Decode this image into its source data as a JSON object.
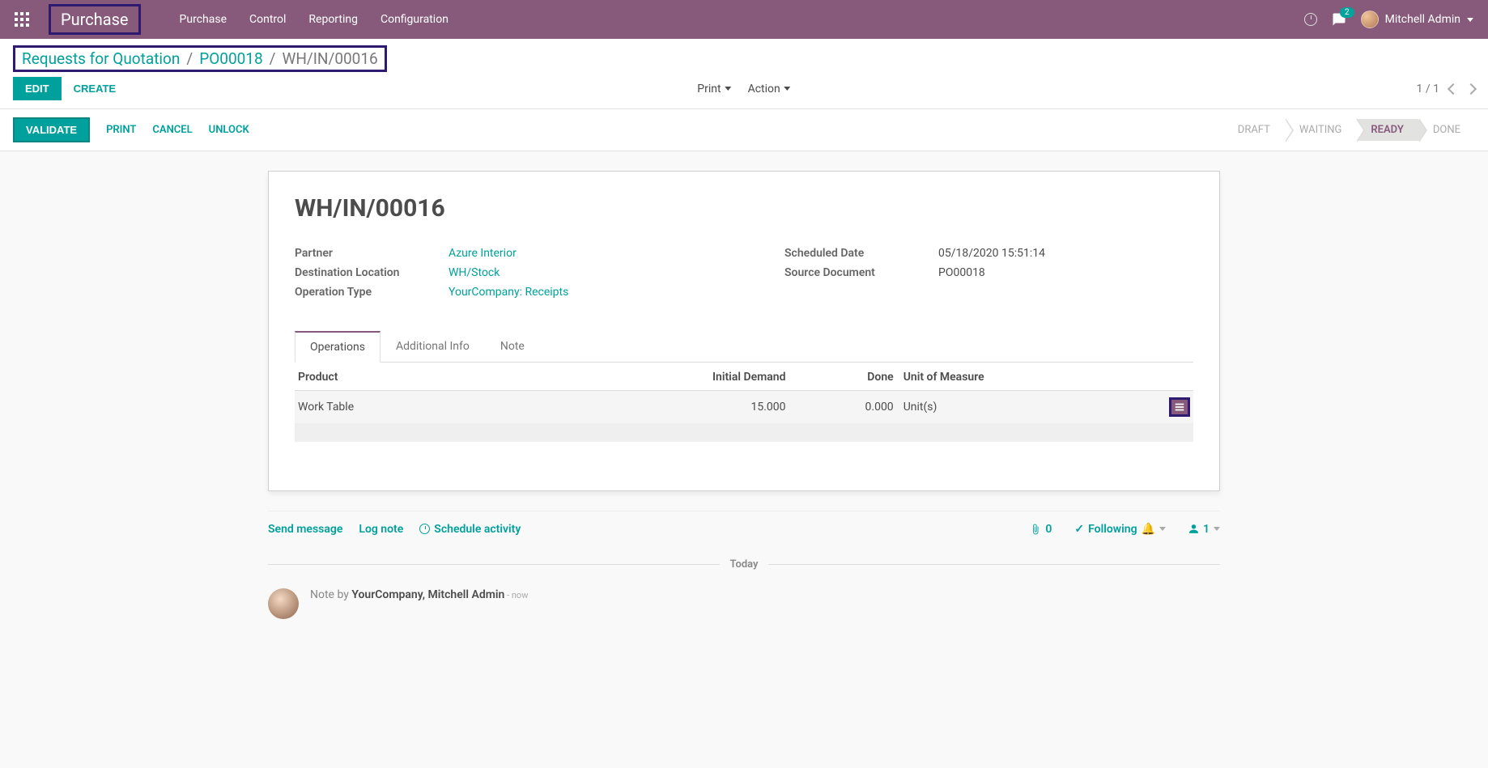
{
  "topnav": {
    "brand": "Purchase",
    "menu": [
      "Purchase",
      "Control",
      "Reporting",
      "Configuration"
    ],
    "chat_count": "2",
    "user": "Mitchell Admin"
  },
  "breadcrumb": {
    "root": "Requests for Quotation",
    "mid": "PO00018",
    "current": "WH/IN/00016"
  },
  "buttons": {
    "edit": "EDIT",
    "create": "CREATE",
    "print": "Print",
    "action": "Action",
    "validate": "VALIDATE",
    "print2": "PRINT",
    "cancel": "CANCEL",
    "unlock": "UNLOCK"
  },
  "pager": {
    "text": "1 / 1"
  },
  "stages": {
    "draft": "DRAFT",
    "waiting": "WAITING",
    "ready": "READY",
    "done": "DONE"
  },
  "record": {
    "name": "WH/IN/00016",
    "fields_left": {
      "partner_label": "Partner",
      "partner_val": "Azure Interior",
      "dest_label": "Destination Location",
      "dest_val": "WH/Stock",
      "optype_label": "Operation Type",
      "optype_val": "YourCompany: Receipts"
    },
    "fields_right": {
      "sched_label": "Scheduled Date",
      "sched_val": "05/18/2020 15:51:14",
      "src_label": "Source Document",
      "src_val": "PO00018"
    }
  },
  "tabs": {
    "ops": "Operations",
    "info": "Additional Info",
    "note": "Note"
  },
  "table": {
    "col_product": "Product",
    "col_initial": "Initial Demand",
    "col_done": "Done",
    "col_uom": "Unit of Measure",
    "row": {
      "product": "Work Table",
      "initial": "15.000",
      "done": "0.000",
      "uom": "Unit(s)"
    }
  },
  "chatter": {
    "send": "Send message",
    "log": "Log note",
    "schedule": "Schedule activity",
    "attach_count": "0",
    "following": "Following",
    "followers": "1",
    "today": "Today",
    "note_prefix": "Note by ",
    "note_author": "YourCompany, Mitchell Admin",
    "note_time": " - now"
  }
}
